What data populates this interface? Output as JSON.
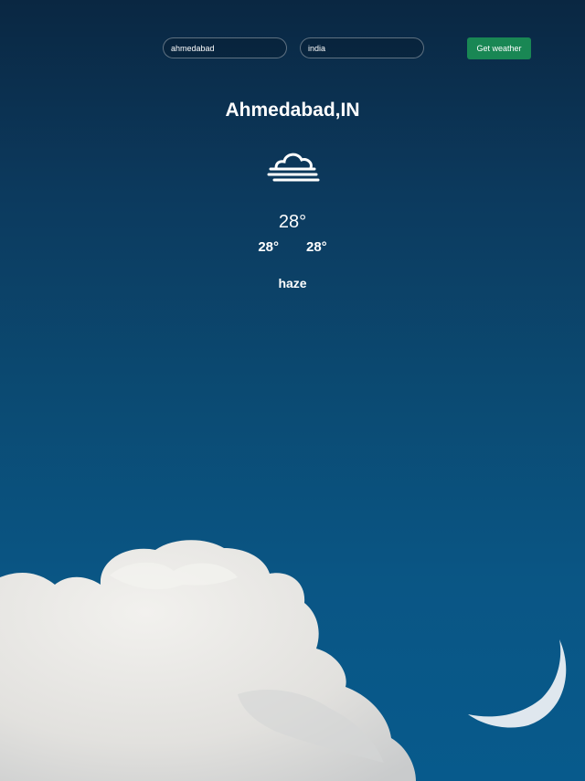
{
  "search": {
    "city_value": "ahmedabad",
    "country_value": "india",
    "button_label": "Get weather"
  },
  "weather": {
    "location": "Ahmedabad,IN",
    "icon": "haze-icon",
    "temp": "28°",
    "temp_min": "28°",
    "temp_max": "28°",
    "description": "haze"
  },
  "colors": {
    "button": "#198754",
    "sky_top": "#0a2742",
    "sky_bottom": "#075a8c",
    "cloud": "#e6e6e4",
    "moon": "#dfe7ee"
  }
}
